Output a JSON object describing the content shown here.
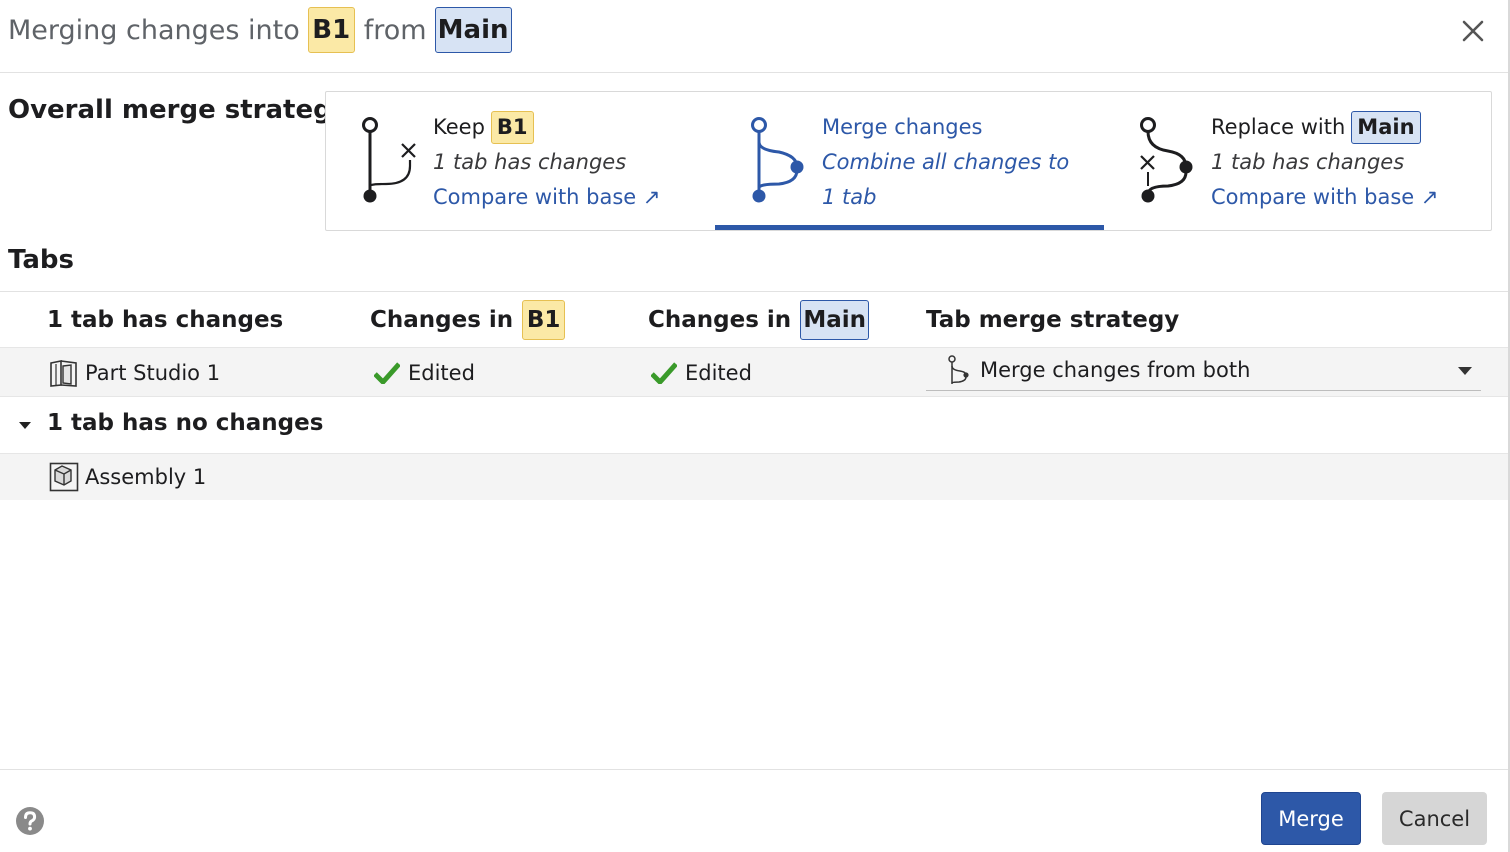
{
  "header": {
    "title_prefix": "Merging changes into",
    "target_branch": "B1",
    "title_middle": "from",
    "source_branch": "Main"
  },
  "overall": {
    "label": "Overall merge strategy",
    "options": [
      {
        "title": "Keep",
        "badge": "B1",
        "subtitle": "1 tab has changes",
        "link": "Compare with base ↗",
        "selected": false
      },
      {
        "title": "Merge changes",
        "subtitle": "Combine all changes to 1 tab",
        "selected": true
      },
      {
        "title": "Replace with",
        "badge": "Main",
        "subtitle": "1 tab has changes",
        "link": "Compare with base ↗",
        "selected": false
      }
    ]
  },
  "tabs": {
    "heading": "Tabs",
    "columns": {
      "changed": "1 tab has changes",
      "changes_in": "Changes in",
      "b1": "B1",
      "main": "Main",
      "strategy": "Tab merge strategy"
    },
    "changed_rows": [
      {
        "name": "Part Studio 1",
        "icon": "part-studio-icon",
        "b1_status": "Edited",
        "main_status": "Edited",
        "strategy": "Merge changes from both"
      }
    ],
    "unchanged_group": {
      "label": "1 tab has no changes",
      "expanded": true,
      "rows": [
        {
          "name": "Assembly 1",
          "icon": "assembly-icon"
        }
      ]
    }
  },
  "footer": {
    "merge_label": "Merge",
    "cancel_label": "Cancel"
  },
  "colors": {
    "accent": "#2d58a8",
    "b1_badge_bg": "#fbe9a6",
    "main_badge_bg": "#d7e3f4",
    "check_green": "#3a9a2a"
  }
}
